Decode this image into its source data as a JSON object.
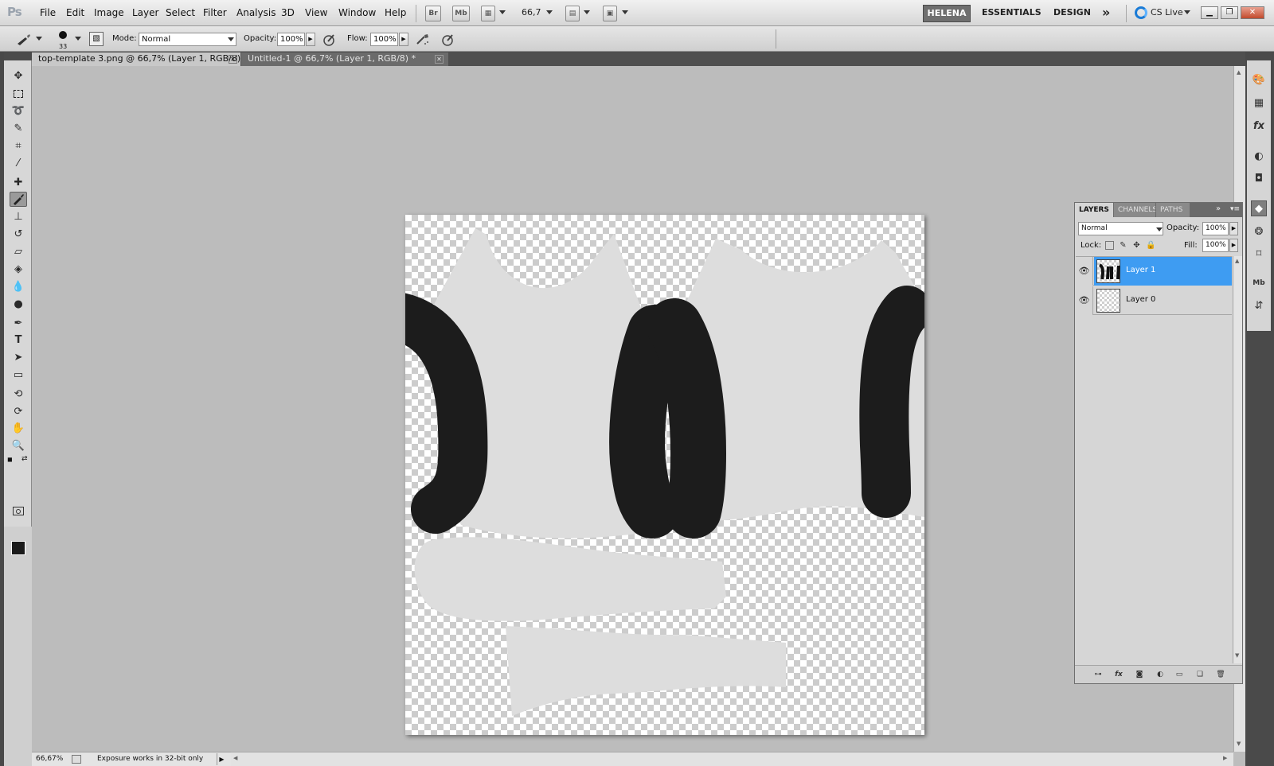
{
  "app": {
    "logo": "Ps"
  },
  "menu": [
    "File",
    "Edit",
    "Image",
    "Layer",
    "Select",
    "Filter",
    "Analysis",
    "3D",
    "View",
    "Window",
    "Help"
  ],
  "menubar": {
    "bridge_btn": "Br",
    "minibridge_btn": "Mb",
    "zoom_value": "66,7",
    "workspaces": {
      "active": "HELENA",
      "essentials": "ESSENTIALS",
      "design": "DESIGN",
      "more": "»"
    },
    "cs_live": "CS Live"
  },
  "options": {
    "brush_size": "33",
    "mode_label": "Mode:",
    "mode_value": "Normal",
    "opacity_label": "Opacity:",
    "opacity_value": "100%",
    "flow_label": "Flow:",
    "flow_value": "100%"
  },
  "tabs": [
    {
      "label": "top-template 3.png @ 66,7% (Layer 1, RGB/8) *",
      "active": true
    },
    {
      "label": "Untitled-1 @ 66,7% (Layer 1, RGB/8) *",
      "active": false
    }
  ],
  "colors": {
    "foreground": "#1b1b1b",
    "background": "#d41a1a",
    "layer_selected": "#3e9cf2"
  },
  "layers_panel": {
    "tabs": [
      "LAYERS",
      "CHANNELS",
      "PATHS"
    ],
    "blend_mode": "Normal",
    "opacity_label": "Opacity:",
    "opacity_value": "100%",
    "lock_label": "Lock:",
    "fill_label": "Fill:",
    "fill_value": "100%",
    "layers": [
      {
        "name": "Layer 1",
        "selected": true,
        "visible": true
      },
      {
        "name": "Layer 0",
        "selected": false,
        "visible": true
      }
    ]
  },
  "status": {
    "zoom": "66,67%",
    "message": "Exposure works in 32-bit only"
  }
}
